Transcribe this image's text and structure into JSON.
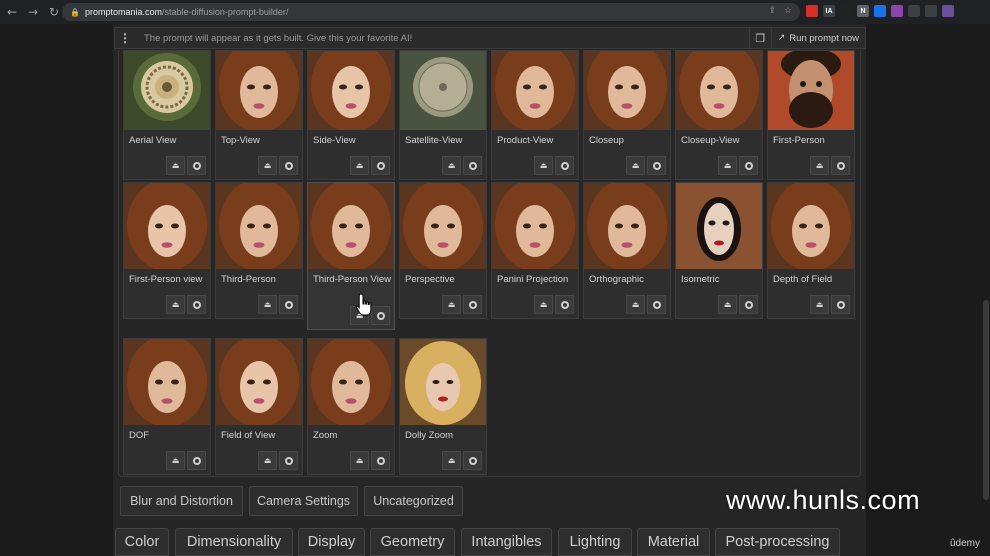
{
  "browser": {
    "url_host": "promptomania.com",
    "url_path": "/stable-diffusion-prompt-builder/",
    "extensions": [
      {
        "name": "ext-red",
        "color": "#d93025",
        "text": ""
      },
      {
        "name": "ext-ia",
        "color": "#3c3f44",
        "text": "IA"
      },
      {
        "name": "ext-dark",
        "color": "#222222",
        "text": ""
      },
      {
        "name": "ext-n",
        "color": "#5f6368",
        "text": "N"
      },
      {
        "name": "ext-blue",
        "color": "#1a73e8",
        "text": ""
      },
      {
        "name": "ext-purple",
        "color": "#8e44ad",
        "text": ""
      },
      {
        "name": "ext-puzzle",
        "color": "#3c3f44",
        "text": ""
      },
      {
        "name": "ext-sidebar",
        "color": "#3c3f44",
        "text": ""
      },
      {
        "name": "ext-avatar",
        "color": "#6b4f9a",
        "text": ""
      }
    ]
  },
  "prompt_bar": {
    "placeholder": "The prompt will appear as it gets built. Give this your favorite AI!",
    "run_label": "Run prompt now"
  },
  "cards": [
    {
      "label": "Aerial View",
      "thumb": "mandala"
    },
    {
      "label": "Top-View",
      "thumb": "woman"
    },
    {
      "label": "Side-View",
      "thumb": "woman-light"
    },
    {
      "label": "Satellite-View",
      "thumb": "satellite"
    },
    {
      "label": "Product-View",
      "thumb": "woman"
    },
    {
      "label": "Closeup",
      "thumb": "woman"
    },
    {
      "label": "Closeup-View",
      "thumb": "woman"
    },
    {
      "label": "First-Person",
      "thumb": "man"
    },
    {
      "label": "First-Person view",
      "thumb": "woman-light"
    },
    {
      "label": "Third-Person",
      "thumb": "woman"
    },
    {
      "label": "Third-Person View",
      "thumb": "woman"
    },
    {
      "label": "Perspective",
      "thumb": "woman"
    },
    {
      "label": "Panini Projection",
      "thumb": "woman"
    },
    {
      "label": "Orthographic",
      "thumb": "woman"
    },
    {
      "label": "Isometric",
      "thumb": "isometric"
    },
    {
      "label": "Depth of Field",
      "thumb": "woman"
    },
    {
      "label": "DOF",
      "thumb": "woman"
    },
    {
      "label": "Field of View",
      "thumb": "woman-light"
    },
    {
      "label": "Zoom",
      "thumb": "woman"
    },
    {
      "label": "Dolly Zoom",
      "thumb": "blonde"
    }
  ],
  "categories": [
    "Blur and Distortion",
    "Camera Settings",
    "Uncategorized"
  ],
  "tabs": [
    "Color",
    "Dimensionality",
    "Display",
    "Geometry",
    "Intangibles",
    "Lighting",
    "Material",
    "Post-processing"
  ],
  "watermark": "www.hunls.com",
  "udemy": "ûdemy",
  "colors": {
    "panel": "#262626",
    "card": "#2e2e2e",
    "hair": "#7a3d1c",
    "skin": "#e0b89a"
  }
}
